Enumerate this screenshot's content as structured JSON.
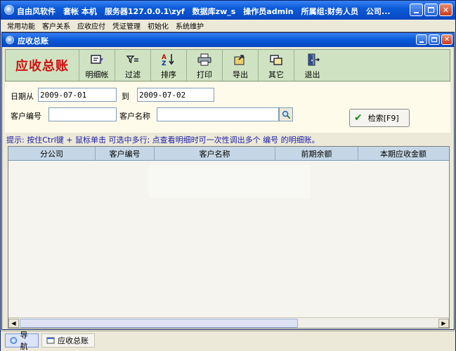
{
  "window": {
    "title": "自由风软件　套帐 本机　服务器127.0.0.1\\zyf　数据库zw_s　操作员admin　所属组:财务人员　公司..."
  },
  "menu": [
    "常用功能",
    "客户关系",
    "应收应付",
    "凭证管理",
    "初始化",
    "系统维护"
  ],
  "inner_window": {
    "title": "应收总账"
  },
  "toolbar": {
    "brand": "应收总账",
    "buttons": [
      {
        "label": "明细帐",
        "icon": "detail-icon"
      },
      {
        "label": "过滤",
        "icon": "filter-icon"
      },
      {
        "label": "排序",
        "icon": "sort-icon"
      },
      {
        "label": "打印",
        "icon": "print-icon"
      },
      {
        "label": "导出",
        "icon": "export-icon"
      },
      {
        "label": "其它",
        "icon": "other-icon"
      },
      {
        "label": "退出",
        "icon": "exit-icon"
      }
    ]
  },
  "filter": {
    "date_from_label": "日期从",
    "date_from": "2009-07-01",
    "date_to_label": "到",
    "date_to": "2009-07-02",
    "customer_code_label": "客户编号",
    "customer_code": "",
    "customer_name_label": "客户名称",
    "customer_name": "",
    "search_button": "检索[F9]"
  },
  "hint": "提示: 按住Ctrl键 + 鼠标单击 可选中多行; 点查看明细时可一次性调出多个 编号 的明细账。",
  "table": {
    "columns": [
      "分公司",
      "客户编号",
      "客户名称",
      "前期余额",
      "本期应收金额"
    ],
    "rows": []
  },
  "taskbar": {
    "items": [
      "导航",
      "应收总账"
    ]
  },
  "colors": {
    "titlebar": "#0a5bd9",
    "toolbar_bg": "#cfe3c2",
    "brand_text": "#d01010",
    "hint_text": "#1a1aa8",
    "grid_header": "#c5d7e6"
  }
}
